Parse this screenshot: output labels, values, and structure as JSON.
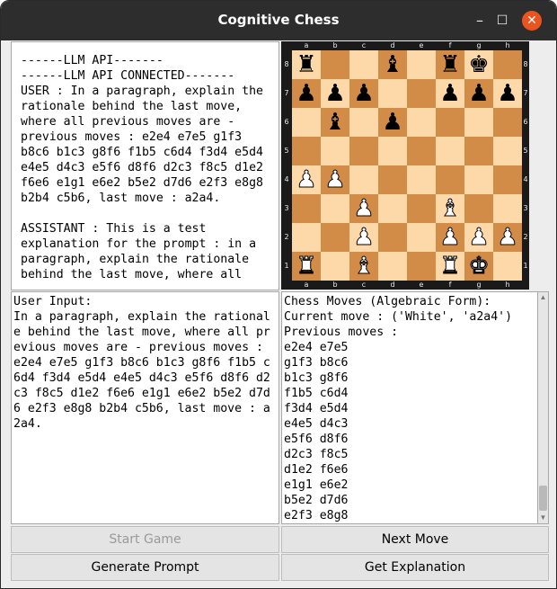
{
  "window": {
    "title": "Cognitive Chess",
    "minimize_glyph": "–",
    "maximize_glyph": "☐",
    "close_glyph": "✕"
  },
  "llm_panel": {
    "text": "------LLM API-------\n------LLM API CONNECTED-------\nUSER : In a paragraph, explain the\nrationale behind the last move,\nwhere all previous moves are -\nprevious moves : e2e4 e7e5 g1f3\nb8c6 b1c3 g8f6 f1b5 c6d4 f3d4 e5d4\ne4e5 d4c3 e5f6 d8f6 d2c3 f8c5 d1e2\nf6e6 e1g1 e6e2 b5e2 d7d6 e2f3 e8g8\nb2b4 c5b6, last move : a2a4.\n\nASSISTANT : This is a test\nexplanation for the prompt : in a\nparagraph, explain the rationale\nbehind the last move, where all"
  },
  "board": {
    "files": [
      "a",
      "b",
      "c",
      "d",
      "e",
      "f",
      "g",
      "h"
    ],
    "ranks": [
      "8",
      "7",
      "6",
      "5",
      "4",
      "3",
      "2",
      "1"
    ],
    "position": [
      [
        "br",
        "",
        "",
        "bb",
        "",
        "br",
        "bk",
        ""
      ],
      [
        "bp",
        "bp",
        "bp",
        "",
        "",
        "bp",
        "bp",
        "bp"
      ],
      [
        "",
        "bb",
        "",
        "bp",
        "",
        "",
        "",
        ""
      ],
      [
        "",
        "",
        "",
        "",
        "",
        "",
        "",
        ""
      ],
      [
        "wp",
        "wp",
        "",
        "",
        "",
        "",
        "",
        ""
      ],
      [
        "",
        "",
        "wp",
        "",
        "",
        "wb",
        "",
        ""
      ],
      [
        "",
        "",
        "wp",
        "",
        "",
        "wp",
        "wp",
        "wp"
      ],
      [
        "wr",
        "",
        "wb",
        "",
        "",
        "wr",
        "wk",
        ""
      ]
    ],
    "light_color": "#fdd8a8",
    "dark_color": "#d28c47"
  },
  "user_input": {
    "text": "User Input:\nIn a paragraph, explain the rational\ne behind the last move, where all pr\nevious moves are - previous moves :\ne2e4 e7e5 g1f3 b8c6 b1c3 g8f6 f1b5 c\n6d4 f3d4 e5d4 e4e5 d4c3 e5f6 d8f6 d2\nc3 f8c5 d1e2 f6e6 e1g1 e6e2 b5e2 d7d\n6 e2f3 e8g8 b2b4 c5b6, last move : a\n2a4."
  },
  "moves_panel": {
    "text": "Chess Moves (Algebraic Form):\nCurrent move : ('White', 'a2a4')\nPrevious moves :\ne2e4 e7e5\ng1f3 b8c6\nb1c3 g8f6\nf1b5 c6d4\nf3d4 e5d4\ne4e5 d4c3\ne5f6 d8f6\nd2c3 f8c5\nd1e2 f6e6\ne1g1 e6e2\nb5e2 d7d6\ne2f3 e8g8"
  },
  "buttons": {
    "start_game": "Start Game",
    "next_move": "Next Move",
    "generate_prompt": "Generate Prompt",
    "get_explanation": "Get Explanation"
  }
}
